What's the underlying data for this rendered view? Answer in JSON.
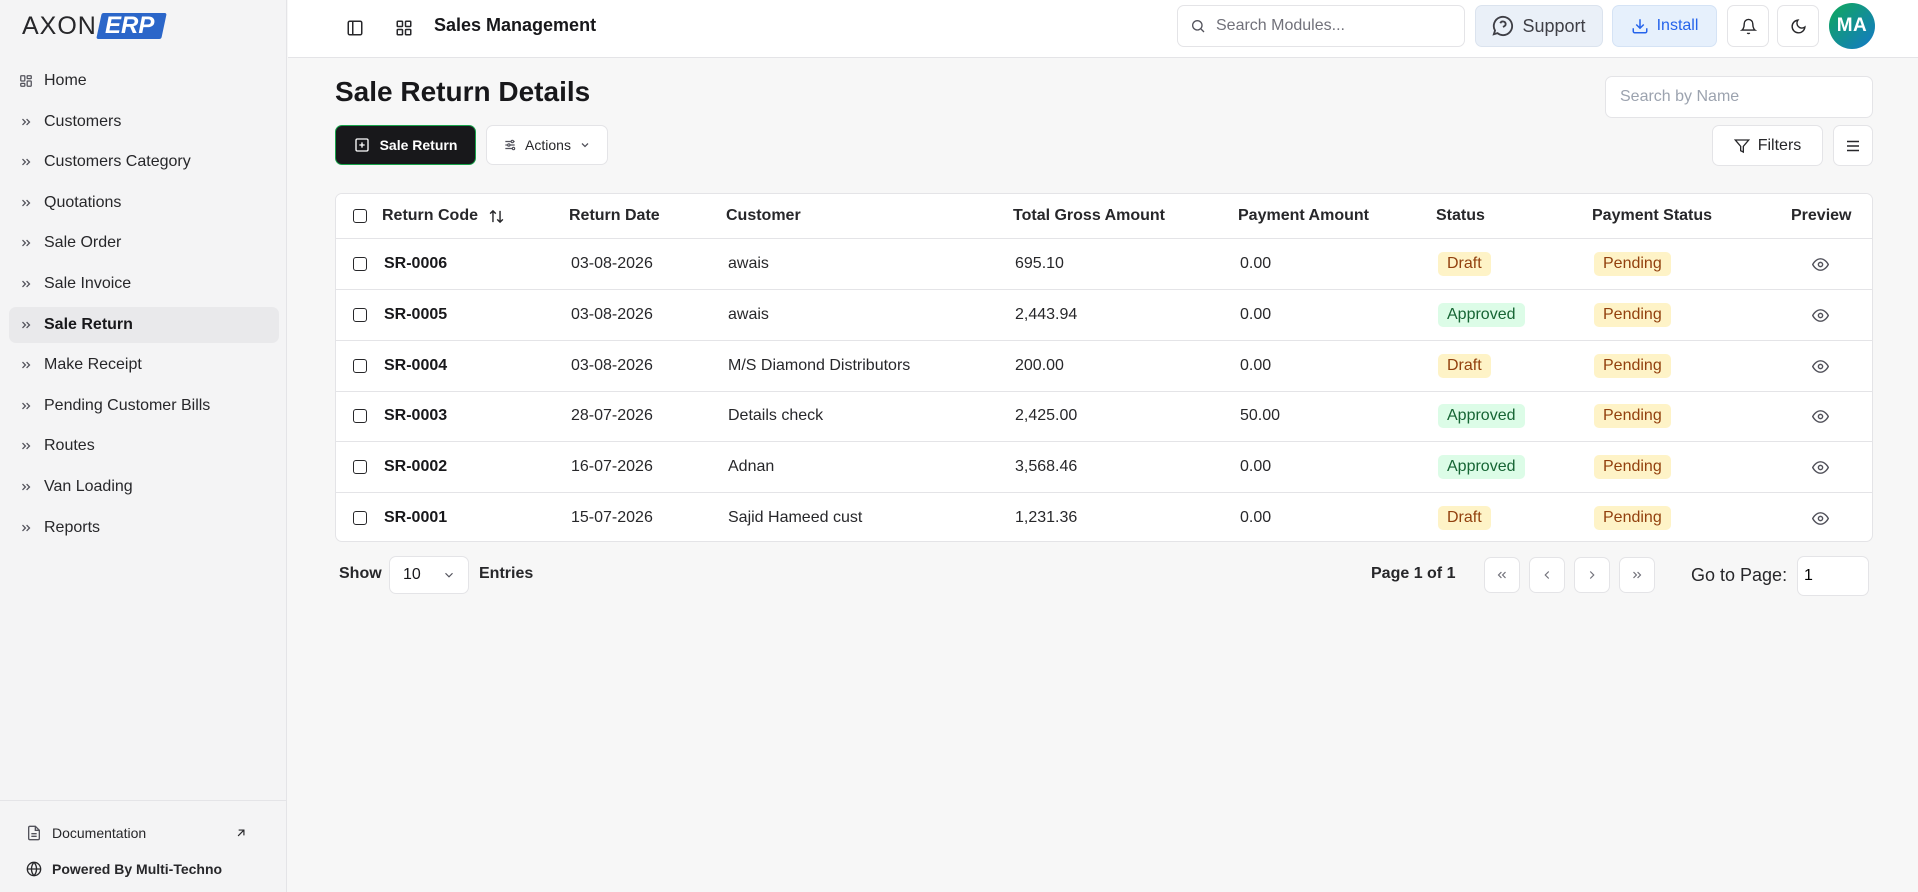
{
  "brand": {
    "logo_left": "AXON",
    "logo_right": "ERP",
    "accent": "#2b66c9"
  },
  "sidebar": {
    "items": [
      {
        "label": "Home",
        "icon": "grid-icon"
      },
      {
        "label": "Customers",
        "icon": "chevrons-right-icon"
      },
      {
        "label": "Customers Category",
        "icon": "chevrons-right-icon"
      },
      {
        "label": "Quotations",
        "icon": "chevrons-right-icon"
      },
      {
        "label": "Sale Order",
        "icon": "chevrons-right-icon"
      },
      {
        "label": "Sale Invoice",
        "icon": "chevrons-right-icon"
      },
      {
        "label": "Sale Return",
        "icon": "chevrons-right-icon",
        "active": true
      },
      {
        "label": "Make Receipt",
        "icon": "chevrons-right-icon"
      },
      {
        "label": "Pending Customer Bills",
        "icon": "chevrons-right-icon"
      },
      {
        "label": "Routes",
        "icon": "chevrons-right-icon"
      },
      {
        "label": "Van Loading",
        "icon": "chevrons-right-icon"
      },
      {
        "label": "Reports",
        "icon": "chevrons-right-icon"
      }
    ],
    "documentation": "Documentation",
    "powered_by": "Powered By Multi-Techno"
  },
  "header": {
    "module_title": "Sales Management",
    "search_placeholder": "Search Modules...",
    "support_label": "Support",
    "install_label": "Install",
    "avatar_initials": "MA"
  },
  "main": {
    "page_title": "Sale Return Details",
    "search_placeholder": "Search by Name",
    "add_button": "Sale Return",
    "actions_button": "Actions",
    "filters_button": "Filters"
  },
  "table": {
    "columns": [
      "Return Code",
      "Return Date",
      "Customer",
      "Total Gross Amount",
      "Payment Amount",
      "Status",
      "Payment Status",
      "Preview"
    ],
    "rows": [
      {
        "code": "SR-0006",
        "date": "03-08-2026",
        "customer": "awais",
        "gross": "695.10",
        "payment": "0.00",
        "status": "Draft",
        "payment_status": "Pending"
      },
      {
        "code": "SR-0005",
        "date": "03-08-2026",
        "customer": "awais",
        "gross": "2,443.94",
        "payment": "0.00",
        "status": "Approved",
        "payment_status": "Pending"
      },
      {
        "code": "SR-0004",
        "date": "03-08-2026",
        "customer": "M/S Diamond Distributors",
        "gross": "200.00",
        "payment": "0.00",
        "status": "Draft",
        "payment_status": "Pending"
      },
      {
        "code": "SR-0003",
        "date": "28-07-2026",
        "customer": "Details check",
        "gross": "2,425.00",
        "payment": "50.00",
        "status": "Approved",
        "payment_status": "Pending"
      },
      {
        "code": "SR-0002",
        "date": "16-07-2026",
        "customer": "Adnan",
        "gross": "3,568.46",
        "payment": "0.00",
        "status": "Approved",
        "payment_status": "Pending"
      },
      {
        "code": "SR-0001",
        "date": "15-07-2026",
        "customer": "Sajid Hameed cust",
        "gross": "1,231.36",
        "payment": "0.00",
        "status": "Draft",
        "payment_status": "Pending"
      }
    ]
  },
  "pagination": {
    "show_label": "Show",
    "page_size": "10",
    "entries_label": "Entries",
    "page_info": "Page 1 of 1",
    "goto_label": "Go to Page:",
    "goto_value": "1"
  },
  "colors": {
    "draft_bg": "#fef3c7",
    "approved_bg": "#dcfce7",
    "pending_bg": "#fef3c7",
    "primary_btn": "#18181b"
  }
}
